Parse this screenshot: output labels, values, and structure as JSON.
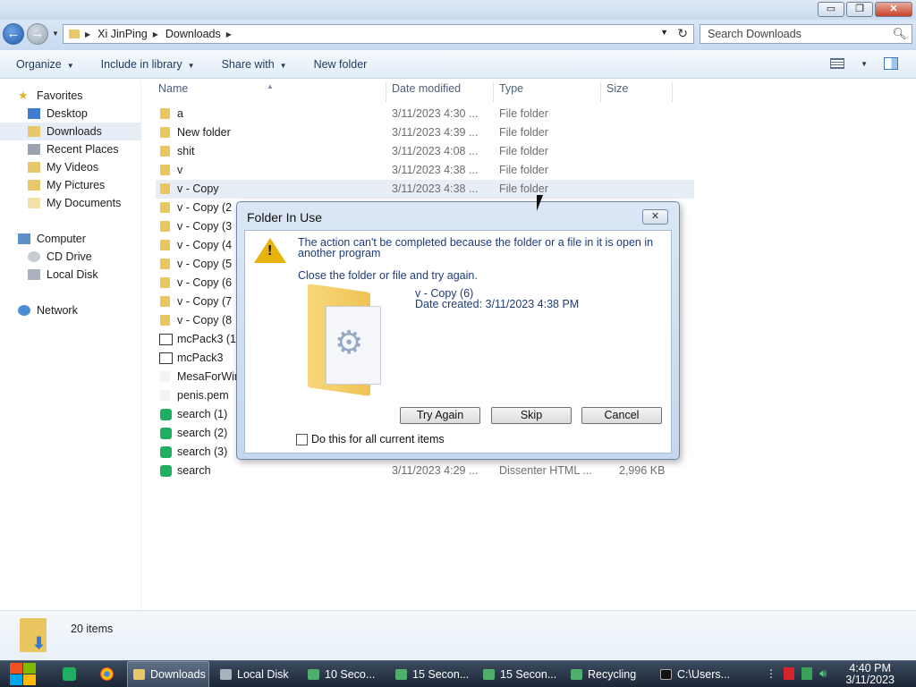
{
  "window": {
    "minimize_glyph": "▭",
    "maximize_glyph": "❐",
    "close_glyph": "✕"
  },
  "address": {
    "crumbs": [
      "Xi JinPing",
      "Downloads"
    ],
    "search_placeholder": "Search Downloads"
  },
  "toolbar": {
    "organize": "Organize",
    "include_library": "Include in library",
    "share_with": "Share with",
    "new_folder": "New folder"
  },
  "nav": {
    "favorites": "Favorites",
    "desktop": "Desktop",
    "downloads": "Downloads",
    "recent_places": "Recent Places",
    "my_videos": "My Videos",
    "my_pictures": "My Pictures",
    "my_documents": "My Documents",
    "computer": "Computer",
    "cd_drive": "CD Drive",
    "local_disk": "Local Disk",
    "network": "Network"
  },
  "columns": {
    "name": "Name",
    "date": "Date modified",
    "type": "Type",
    "size": "Size"
  },
  "files": [
    {
      "name": "a",
      "date": "3/11/2023 4:30 ...",
      "type": "File folder",
      "size": "",
      "icon": "folder"
    },
    {
      "name": "New folder",
      "date": "3/11/2023 4:39 ...",
      "type": "File folder",
      "size": "",
      "icon": "folder"
    },
    {
      "name": "shit",
      "date": "3/11/2023 4:08 ...",
      "type": "File folder",
      "size": "",
      "icon": "folder"
    },
    {
      "name": "v",
      "date": "3/11/2023 4:38 ...",
      "type": "File folder",
      "size": "",
      "icon": "folder"
    },
    {
      "name": "v - Copy",
      "date": "3/11/2023 4:38 ...",
      "type": "File folder",
      "size": "",
      "icon": "folder"
    },
    {
      "name": "v - Copy (2",
      "date": "",
      "type": "",
      "size": "",
      "icon": "folder"
    },
    {
      "name": "v - Copy (3",
      "date": "",
      "type": "",
      "size": "",
      "icon": "folder"
    },
    {
      "name": "v - Copy (4",
      "date": "",
      "type": "",
      "size": "",
      "icon": "folder"
    },
    {
      "name": "v - Copy (5",
      "date": "",
      "type": "",
      "size": "",
      "icon": "folder"
    },
    {
      "name": "v - Copy (6",
      "date": "",
      "type": "",
      "size": "",
      "icon": "folder"
    },
    {
      "name": "v - Copy (7",
      "date": "",
      "type": "",
      "size": "",
      "icon": "folder"
    },
    {
      "name": "v - Copy (8",
      "date": "",
      "type": "",
      "size": "",
      "icon": "folder"
    },
    {
      "name": "mcPack3 (1",
      "date": "",
      "type": "",
      "size": "",
      "icon": "pack"
    },
    {
      "name": "mcPack3",
      "date": "",
      "type": "",
      "size": "",
      "icon": "pack"
    },
    {
      "name": "MesaForWir",
      "date": "",
      "type": "",
      "size": "",
      "icon": "doc"
    },
    {
      "name": "penis.pem",
      "date": "",
      "type": "",
      "size": "",
      "icon": "doc"
    },
    {
      "name": "search (1)",
      "date": "",
      "type": "",
      "size": "",
      "icon": "green"
    },
    {
      "name": "search (2)",
      "date": "",
      "type": "",
      "size": "",
      "icon": "green"
    },
    {
      "name": "search (3)",
      "date": "",
      "type": "",
      "size": "",
      "icon": "green"
    },
    {
      "name": "search",
      "date": "3/11/2023 4:29 ...",
      "type": "Dissenter HTML ...",
      "size": "2,996 KB",
      "icon": "green"
    }
  ],
  "details": {
    "item_count": "20 items"
  },
  "dialog": {
    "title": "Folder In Use",
    "close_glyph": "✕",
    "message_line1": "The action can't be completed because the folder or a file in it is open in",
    "message_line2": "another program",
    "instruction": "Close the folder or file and try again.",
    "file_name": "v - Copy (6)",
    "date_created": "Date created: 3/11/2023 4:38 PM",
    "try_again": "Try Again",
    "skip": "Skip",
    "cancel": "Cancel",
    "checkbox_label": "Do this for all current items"
  },
  "taskbar": {
    "tasks": [
      "Downloads",
      "Local Disk",
      "10 Seco...",
      "15 Secon...",
      "15 Secon...",
      "Recycling",
      "C:\\Users..."
    ],
    "time": "4:40 PM",
    "date": "3/11/2023"
  }
}
